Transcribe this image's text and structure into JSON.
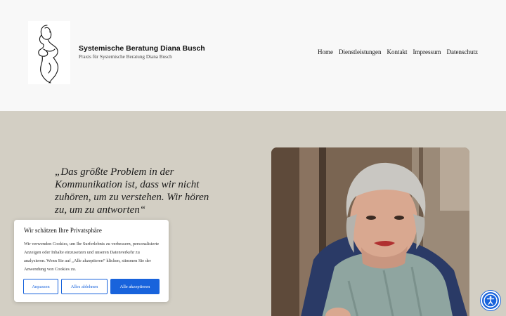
{
  "site": {
    "title": "Systemische Beratung Diana Busch",
    "tagline": "Praxis für Systemische Beratung Diana Busch"
  },
  "nav": {
    "items": [
      "Home",
      "Dienstleistungen",
      "Kontakt",
      "Impressum",
      "Datenschutz"
    ]
  },
  "hero": {
    "quote": "„Das größte Problem in der Kommunikation ist, dass wir nicht zuhören, um zu verstehen. Wir hören zu, um zu antworten“"
  },
  "cookie": {
    "title": "Wir schätzen Ihre Privatsphäre",
    "text": "Wir verwenden Cookies, um Ihr Surferlebnis zu verbessern, personalisierte Anzeigen oder Inhalte einzusetzen und unseren Datenverkehr zu analysieren. Wenn Sie auf „Alle akzeptieren“ klicken, stimmen Sie der Anwendung von Cookies zu.",
    "buttons": {
      "customize": "Anpassen",
      "reject": "Alles ablehnen",
      "accept": "Alle akzeptieren"
    }
  },
  "icons": {
    "logo": "line-art-woman-logo",
    "accessibility": "accessibility-icon"
  },
  "colors": {
    "accent": "#1863dc",
    "hero_bg": "#d3cfc4",
    "header_bg": "#f8f8f8"
  }
}
